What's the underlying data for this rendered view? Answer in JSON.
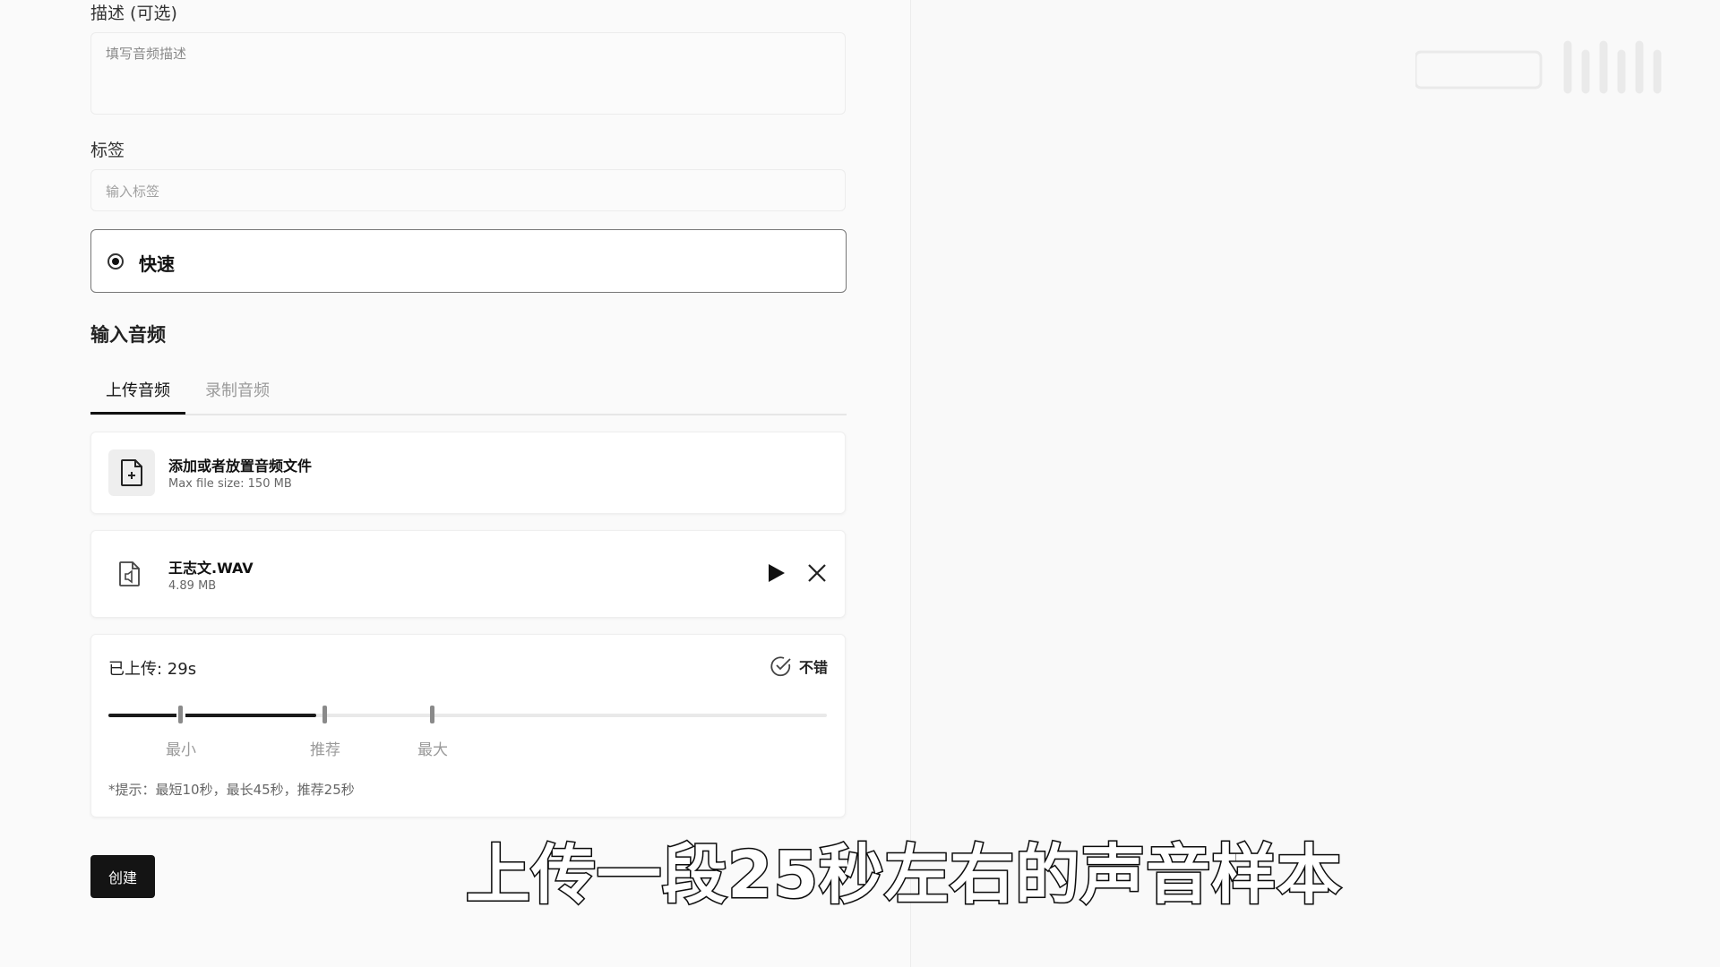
{
  "form": {
    "description_label": "描述 (可选)",
    "description_placeholder": "填写音频描述",
    "tags_label": "标签",
    "tags_placeholder": "输入标签",
    "mode_option_label": "快速",
    "input_audio_title": "输入音频"
  },
  "tabs": [
    {
      "label": "上传音频",
      "active": true
    },
    {
      "label": "录制音频",
      "active": false
    }
  ],
  "upload": {
    "title": "添加或者放置音频文件",
    "subtitle": "Max file size: 150 MB",
    "icon": "file-add-icon"
  },
  "file": {
    "name": "王志文.WAV",
    "size": "4.89 MB",
    "icon": "audio-file-icon"
  },
  "duration": {
    "title": "已上传: 29s",
    "status": "不错",
    "markers": [
      "最小",
      "推荐",
      "最大"
    ],
    "marker_seconds": [
      10,
      25,
      45
    ],
    "uploaded_seconds": 29,
    "hint": "*提示：最短10秒，最长45秒，推荐25秒"
  },
  "actions": {
    "create_label": "创建"
  },
  "overlay": {
    "subtitle": "上传一段25秒左右的声音样本"
  },
  "colors": {
    "primary": "#141414",
    "border": "#ececec",
    "muted": "#9a9a9a"
  }
}
